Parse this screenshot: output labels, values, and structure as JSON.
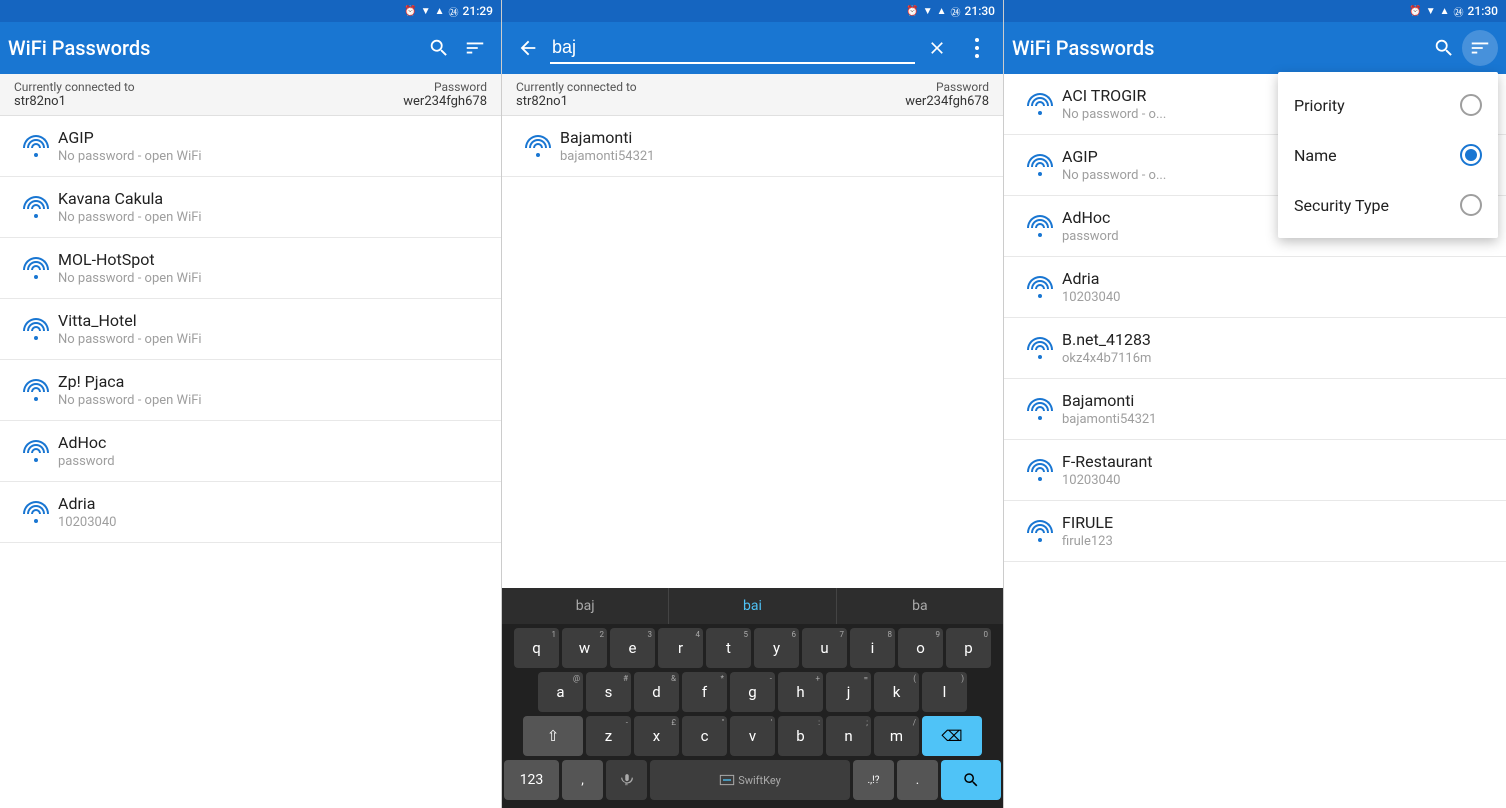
{
  "panels": {
    "left": {
      "statusBar": {
        "time": "21:29",
        "icons": [
          "alarm",
          "wifi",
          "signal",
          "battery"
        ]
      },
      "toolbar": {
        "title": "WiFi Passwords",
        "searchLabel": "search",
        "filterLabel": "filter"
      },
      "infoBar": {
        "connectedLabel": "Currently connected to",
        "ssid": "str82no1",
        "passwordLabel": "Password",
        "password": "wer234fgh678"
      },
      "wifiList": [
        {
          "name": "AGIP",
          "sub": "No password - open WiFi"
        },
        {
          "name": "Kavana Cakula",
          "sub": "No password - open WiFi"
        },
        {
          "name": "MOL-HotSpot",
          "sub": "No password - open WiFi"
        },
        {
          "name": "Vitta_Hotel",
          "sub": "No password - open WiFi"
        },
        {
          "name": "Zp! Pjaca",
          "sub": "No password - open WiFi"
        },
        {
          "name": "AdHoc",
          "sub": "password"
        },
        {
          "name": "Adria",
          "sub": "10203040"
        }
      ]
    },
    "mid": {
      "statusBar": {
        "time": "21:30"
      },
      "toolbar": {
        "searchValue": "baj",
        "backLabel": "back",
        "clearLabel": "clear",
        "moreLabel": "more"
      },
      "infoBar": {
        "connectedLabel": "Currently connected to",
        "ssid": "str82no1",
        "passwordLabel": "Password",
        "password": "wer234fgh678"
      },
      "wifiList": [
        {
          "name": "Bajamonti",
          "sub": "bajamonti54321"
        }
      ],
      "keyboard": {
        "suggestions": [
          {
            "text": "baj",
            "type": "normal"
          },
          {
            "text": "bai",
            "type": "highlight"
          },
          {
            "text": "ba",
            "type": "dim"
          }
        ],
        "rows": [
          {
            "keys": [
              {
                "label": "q",
                "sub": "1"
              },
              {
                "label": "w",
                "sub": "2"
              },
              {
                "label": "e",
                "sub": "3"
              },
              {
                "label": "r",
                "sub": "4"
              },
              {
                "label": "t",
                "sub": "5"
              },
              {
                "label": "y",
                "sub": "6"
              },
              {
                "label": "u",
                "sub": "7"
              },
              {
                "label": "i",
                "sub": "8"
              },
              {
                "label": "o",
                "sub": "9"
              },
              {
                "label": "p",
                "sub": "0"
              }
            ]
          },
          {
            "keys": [
              {
                "label": "a",
                "sub": "@"
              },
              {
                "label": "s",
                "sub": "#"
              },
              {
                "label": "d",
                "sub": "&"
              },
              {
                "label": "f",
                "sub": "*"
              },
              {
                "label": "g",
                "sub": "-"
              },
              {
                "label": "h",
                "sub": "+"
              },
              {
                "label": "j",
                "sub": "="
              },
              {
                "label": "k",
                "sub": "("
              },
              {
                "label": "l",
                "sub": ")"
              }
            ]
          },
          {
            "keys": [
              {
                "label": "⇧",
                "type": "shift"
              },
              {
                "label": "z",
                "sub": "-"
              },
              {
                "label": "x",
                "sub": "£"
              },
              {
                "label": "c",
                "sub": "\""
              },
              {
                "label": "v",
                "sub": "'"
              },
              {
                "label": "b",
                "sub": ":"
              },
              {
                "label": "n",
                "sub": ";"
              },
              {
                "label": "m",
                "sub": "/"
              },
              {
                "label": "⌫",
                "type": "delete"
              }
            ]
          },
          {
            "keys": [
              {
                "label": "123",
                "type": "num"
              },
              {
                "label": ",",
                "type": "sym"
              },
              {
                "label": "🎤",
                "type": "mic"
              },
              {
                "label": " ",
                "type": "space",
                "swiftkey": "SwiftKey"
              },
              {
                "label": ".,!?",
                "type": "sym"
              },
              {
                "label": ".",
                "type": "sym"
              },
              {
                "label": "🔍",
                "type": "search"
              }
            ]
          }
        ]
      }
    },
    "right": {
      "statusBar": {
        "time": "21:30"
      },
      "toolbar": {
        "title": "WiFi Passwords",
        "searchLabel": "search",
        "filterLabel": "filter"
      },
      "wifiList": [
        {
          "name": "ACI TROGIR",
          "sub": "No password - o..."
        },
        {
          "name": "AGIP",
          "sub": "No password - o..."
        },
        {
          "name": "AdHoc",
          "sub": "password"
        },
        {
          "name": "Adria",
          "sub": "10203040"
        },
        {
          "name": "B.net_41283",
          "sub": "okz4x4b7116m"
        },
        {
          "name": "Bajamonti",
          "sub": "bajamonti54321"
        },
        {
          "name": "F-Restaurant",
          "sub": "10203040"
        },
        {
          "name": "FIRULE",
          "sub": "firule123"
        }
      ],
      "dropdown": {
        "items": [
          {
            "label": "Priority",
            "selected": false
          },
          {
            "label": "Name",
            "selected": true
          },
          {
            "label": "Security Type",
            "selected": false
          }
        ]
      }
    }
  }
}
